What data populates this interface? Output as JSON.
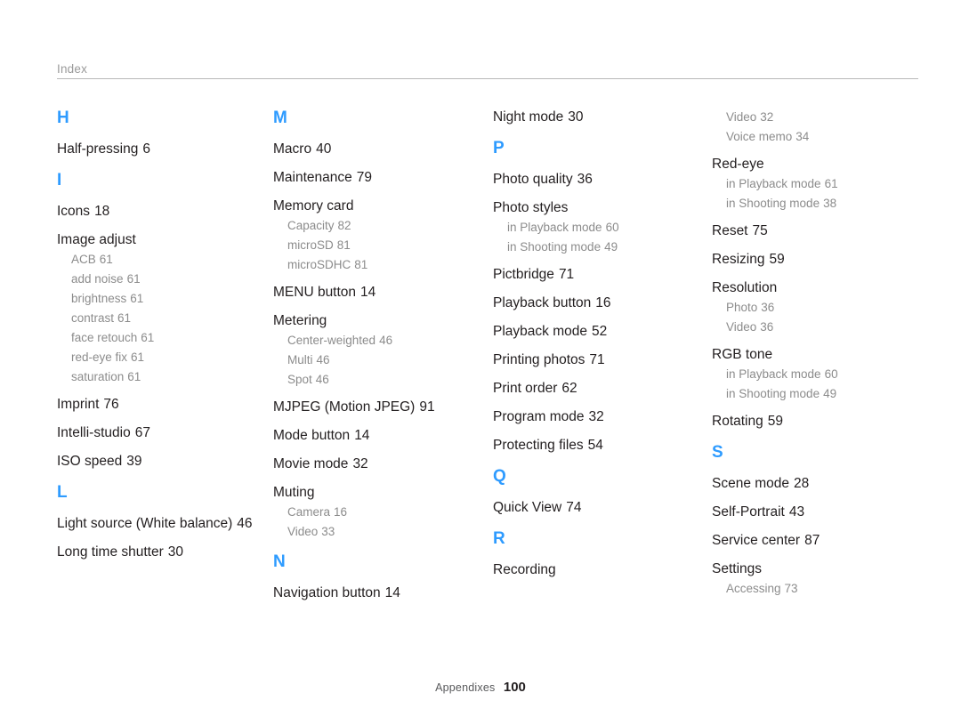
{
  "header": {
    "title": "Index"
  },
  "footer": {
    "label": "Appendixes",
    "page": "100"
  },
  "columns": [
    {
      "id": "column-1",
      "blocks": [
        {
          "type": "letter",
          "text": "H"
        },
        {
          "type": "entry",
          "text": "Half-pressing",
          "page": "6"
        },
        {
          "type": "letter",
          "text": "I"
        },
        {
          "type": "entry",
          "text": "Icons",
          "page": "18"
        },
        {
          "type": "entry",
          "text": "Image adjust",
          "page": ""
        },
        {
          "type": "sub",
          "text": "ACB",
          "page": "61"
        },
        {
          "type": "sub",
          "text": "add noise",
          "page": "61"
        },
        {
          "type": "sub",
          "text": "brightness",
          "page": "61"
        },
        {
          "type": "sub",
          "text": "contrast",
          "page": "61"
        },
        {
          "type": "sub",
          "text": "face retouch",
          "page": "61"
        },
        {
          "type": "sub",
          "text": "red-eye fix",
          "page": "61"
        },
        {
          "type": "sub-last",
          "text": "saturation",
          "page": "61"
        },
        {
          "type": "entry",
          "text": "Imprint",
          "page": "76"
        },
        {
          "type": "entry",
          "text": "Intelli-studio",
          "page": "67"
        },
        {
          "type": "entry",
          "text": "ISO speed",
          "page": "39"
        },
        {
          "type": "letter",
          "text": "L"
        },
        {
          "type": "entry",
          "text": "Light source (White balance)",
          "page": "46"
        },
        {
          "type": "entry",
          "text": "Long time shutter",
          "page": "30"
        }
      ]
    },
    {
      "id": "column-2",
      "blocks": [
        {
          "type": "letter",
          "text": "M"
        },
        {
          "type": "entry",
          "text": "Macro",
          "page": "40"
        },
        {
          "type": "entry",
          "text": "Maintenance",
          "page": "79"
        },
        {
          "type": "entry",
          "text": "Memory card",
          "page": ""
        },
        {
          "type": "sub",
          "text": "Capacity",
          "page": "82"
        },
        {
          "type": "sub",
          "text": "microSD",
          "page": "81"
        },
        {
          "type": "sub-last",
          "text": "microSDHC",
          "page": "81"
        },
        {
          "type": "entry",
          "text": "MENU button",
          "page": "14"
        },
        {
          "type": "entry",
          "text": "Metering",
          "page": ""
        },
        {
          "type": "sub",
          "text": "Center-weighted",
          "page": "46"
        },
        {
          "type": "sub",
          "text": "Multi",
          "page": "46"
        },
        {
          "type": "sub-last",
          "text": "Spot",
          "page": "46"
        },
        {
          "type": "entry",
          "text": "MJPEG (Motion JPEG)",
          "page": "91"
        },
        {
          "type": "entry",
          "text": "Mode button",
          "page": "14"
        },
        {
          "type": "entry",
          "text": "Movie mode",
          "page": "32"
        },
        {
          "type": "entry",
          "text": "Muting",
          "page": ""
        },
        {
          "type": "sub",
          "text": "Camera",
          "page": "16"
        },
        {
          "type": "sub-last",
          "text": "Video",
          "page": "33"
        },
        {
          "type": "letter",
          "text": "N"
        },
        {
          "type": "entry",
          "text": "Navigation button",
          "page": "14"
        }
      ]
    },
    {
      "id": "column-3",
      "blocks": [
        {
          "type": "entry",
          "text": "Night mode",
          "page": "30"
        },
        {
          "type": "letter",
          "text": "P"
        },
        {
          "type": "entry",
          "text": "Photo quality",
          "page": "36"
        },
        {
          "type": "entry",
          "text": "Photo styles",
          "page": ""
        },
        {
          "type": "sub",
          "text": "in Playback mode",
          "page": "60"
        },
        {
          "type": "sub-last",
          "text": "in Shooting mode",
          "page": "49"
        },
        {
          "type": "entry",
          "text": "Pictbridge",
          "page": "71"
        },
        {
          "type": "entry",
          "text": "Playback button",
          "page": "16"
        },
        {
          "type": "entry",
          "text": "Playback mode",
          "page": "52"
        },
        {
          "type": "entry",
          "text": "Printing photos",
          "page": "71"
        },
        {
          "type": "entry",
          "text": "Print order",
          "page": "62"
        },
        {
          "type": "entry",
          "text": "Program mode",
          "page": "32"
        },
        {
          "type": "entry",
          "text": "Protecting files",
          "page": "54"
        },
        {
          "type": "letter",
          "text": "Q"
        },
        {
          "type": "entry",
          "text": "Quick View",
          "page": "74"
        },
        {
          "type": "letter",
          "text": "R"
        },
        {
          "type": "entry",
          "text": "Recording",
          "page": ""
        }
      ]
    },
    {
      "id": "column-4",
      "blocks": [
        {
          "type": "sub",
          "text": "Video",
          "page": "32"
        },
        {
          "type": "sub-last",
          "text": "Voice memo",
          "page": "34"
        },
        {
          "type": "entry",
          "text": "Red-eye",
          "page": ""
        },
        {
          "type": "sub",
          "text": "in Playback mode",
          "page": "61"
        },
        {
          "type": "sub-last",
          "text": "in Shooting mode",
          "page": "38"
        },
        {
          "type": "entry",
          "text": "Reset",
          "page": "75"
        },
        {
          "type": "entry",
          "text": "Resizing",
          "page": "59"
        },
        {
          "type": "entry",
          "text": "Resolution",
          "page": ""
        },
        {
          "type": "sub",
          "text": "Photo",
          "page": "36"
        },
        {
          "type": "sub-last",
          "text": "Video",
          "page": "36"
        },
        {
          "type": "entry",
          "text": "RGB tone",
          "page": ""
        },
        {
          "type": "sub",
          "text": "in Playback mode",
          "page": "60"
        },
        {
          "type": "sub-last",
          "text": "in Shooting mode",
          "page": "49"
        },
        {
          "type": "entry",
          "text": "Rotating",
          "page": "59"
        },
        {
          "type": "letter",
          "text": "S"
        },
        {
          "type": "entry",
          "text": "Scene mode",
          "page": "28"
        },
        {
          "type": "entry",
          "text": "Self-Portrait",
          "page": "43"
        },
        {
          "type": "entry",
          "text": "Service center",
          "page": "87"
        },
        {
          "type": "entry",
          "text": "Settings",
          "page": ""
        },
        {
          "type": "sub-last",
          "text": "Accessing",
          "page": "73"
        }
      ]
    }
  ],
  "colors": {
    "letter_blue": "#2e9bff",
    "entry_text": "#231f20",
    "sub_text": "#8c8c8c",
    "rule": "#b8b8b8",
    "header_text": "#9a9a9a"
  }
}
